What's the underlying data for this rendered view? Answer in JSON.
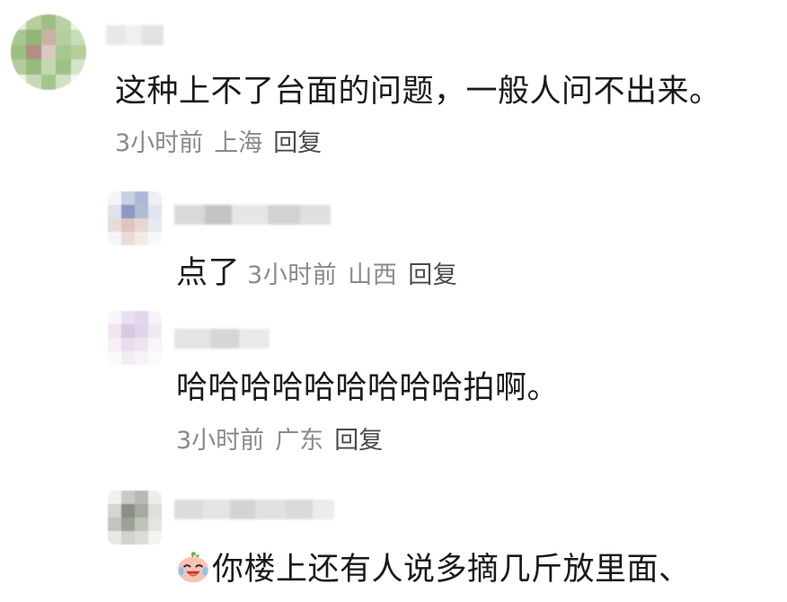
{
  "comments": [
    {
      "text": "这种上不了台面的问题，一般人问不出来。",
      "time": "3小时前",
      "location": "上海",
      "reply_label": "回复"
    },
    {
      "text": "点了",
      "time": "3小时前",
      "location": "山西",
      "reply_label": "回复"
    },
    {
      "text": "哈哈哈哈哈哈哈哈哈拍啊。",
      "time": "3小时前",
      "location": "广东",
      "reply_label": "回复"
    },
    {
      "emoji": "laughing-crying-face-icon",
      "text": "你楼上还有人说多摘几斤放里面、"
    }
  ],
  "colors": {
    "text": "#1a1a1a",
    "meta": "#8a8a8a",
    "reply": "#4a4a4a",
    "background": "#ffffff"
  }
}
